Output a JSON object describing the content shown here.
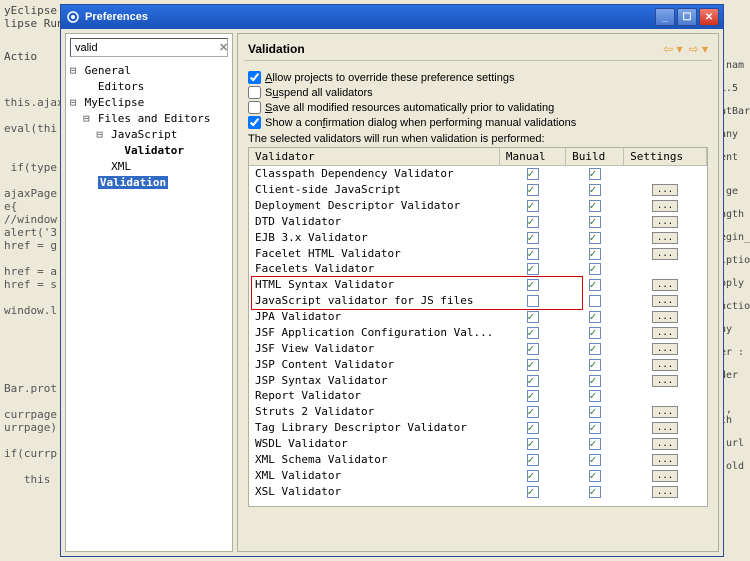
{
  "editor_bg": {
    "title_fragment": "yEclipse",
    "menu_items": [
      "lipse",
      "Run"
    ],
    "toolbar_label": "Actio",
    "code_lines": [
      "",
      "this.ajax",
      "",
      "eval(thi",
      "",
      "",
      " if(type",
      "",
      "ajaxPage",
      "e{",
      "//window",
      "alert('3",
      "href = g",
      "",
      "href = a",
      "href = s",
      "",
      "window.l",
      "",
      "",
      "",
      "",
      "",
      "Bar.prot",
      "",
      "currpage",
      "urrpage)",
      "",
      "if(currp",
      "",
      "   this"
    ],
    "right_fragments": [
      "(nam",
      "1.5",
      "atBar",
      "any",
      "ent :",
      ".ge",
      "ngth",
      "egin_",
      "iptio",
      "pply",
      "nctio",
      "ny",
      "er :",
      "der :",
      "), th",
      "(url",
      "(old"
    ]
  },
  "window": {
    "title": "Preferences"
  },
  "leftpane": {
    "filter_value": "valid",
    "tree": [
      {
        "indent": 0,
        "expander": "⊟",
        "label": "General",
        "bold": false
      },
      {
        "indent": 1,
        "expander": " ",
        "label": "Editors",
        "bold": false
      },
      {
        "indent": 0,
        "expander": "⊟",
        "label": "MyEclipse",
        "bold": false
      },
      {
        "indent": 1,
        "expander": "⊟",
        "label": "Files and Editors",
        "bold": false
      },
      {
        "indent": 2,
        "expander": "⊟",
        "label": "JavaScript",
        "bold": false
      },
      {
        "indent": 3,
        "expander": " ",
        "label": "Validator",
        "bold": true
      },
      {
        "indent": 2,
        "expander": " ",
        "label": "XML",
        "bold": false
      },
      {
        "indent": 1,
        "expander": " ",
        "label": "Validation",
        "bold": true,
        "selected": true
      }
    ]
  },
  "rightpane": {
    "heading": "Validation",
    "options": [
      {
        "checked": true,
        "before": "",
        "ul": "A",
        "after": "llow projects to override these preference settings"
      },
      {
        "checked": false,
        "before": "S",
        "ul": "u",
        "after": "spend all validators"
      },
      {
        "checked": false,
        "before": "",
        "ul": "S",
        "after": "ave all modified resources automatically prior to validating"
      },
      {
        "checked": true,
        "before": "Show a con",
        "ul": "f",
        "after": "irmation dialog when performing manual validations"
      }
    ],
    "description_before": "The selected ",
    "description_ul": "v",
    "description_after": "alidators will run when validation is performed:",
    "columns": [
      "Validator",
      "Manual",
      "Build",
      "Settings"
    ],
    "validators": [
      {
        "name": "Classpath Dependency Validator",
        "manual": true,
        "build": true,
        "settings": false
      },
      {
        "name": "Client-side JavaScript",
        "manual": true,
        "build": true,
        "settings": true
      },
      {
        "name": "Deployment Descriptor Validator",
        "manual": true,
        "build": true,
        "settings": true
      },
      {
        "name": "DTD Validator",
        "manual": true,
        "build": true,
        "settings": true
      },
      {
        "name": "EJB 3.x Validator",
        "manual": true,
        "build": true,
        "settings": true
      },
      {
        "name": "Facelet HTML Validator",
        "manual": true,
        "build": true,
        "settings": true
      },
      {
        "name": "Facelets Validator",
        "manual": true,
        "build": true,
        "settings": false
      },
      {
        "name": "HTML Syntax Validator",
        "manual": true,
        "build": true,
        "settings": true
      },
      {
        "name": "JavaScript validator for JS files",
        "manual": false,
        "build": false,
        "settings": true
      },
      {
        "name": "JPA Validator",
        "manual": true,
        "build": true,
        "settings": true
      },
      {
        "name": "JSF Application Configuration Val...",
        "manual": true,
        "build": true,
        "settings": true
      },
      {
        "name": "JSF View Validator",
        "manual": true,
        "build": true,
        "settings": true
      },
      {
        "name": "JSP Content Validator",
        "manual": true,
        "build": true,
        "settings": true
      },
      {
        "name": "JSP Syntax Validator",
        "manual": true,
        "build": true,
        "settings": true
      },
      {
        "name": "Report Validator",
        "manual": true,
        "build": true,
        "settings": false
      },
      {
        "name": "Struts 2 Validator",
        "manual": true,
        "build": true,
        "settings": true
      },
      {
        "name": "Tag Library Descriptor Validator",
        "manual": true,
        "build": true,
        "settings": true
      },
      {
        "name": "WSDL Validator",
        "manual": true,
        "build": true,
        "settings": true
      },
      {
        "name": "XML Schema Validator",
        "manual": true,
        "build": true,
        "settings": true
      },
      {
        "name": "XML Validator",
        "manual": true,
        "build": true,
        "settings": true
      },
      {
        "name": "XSL Validator",
        "manual": true,
        "build": true,
        "settings": true
      }
    ],
    "highlight_rows": {
      "start": 7,
      "end": 8
    }
  }
}
